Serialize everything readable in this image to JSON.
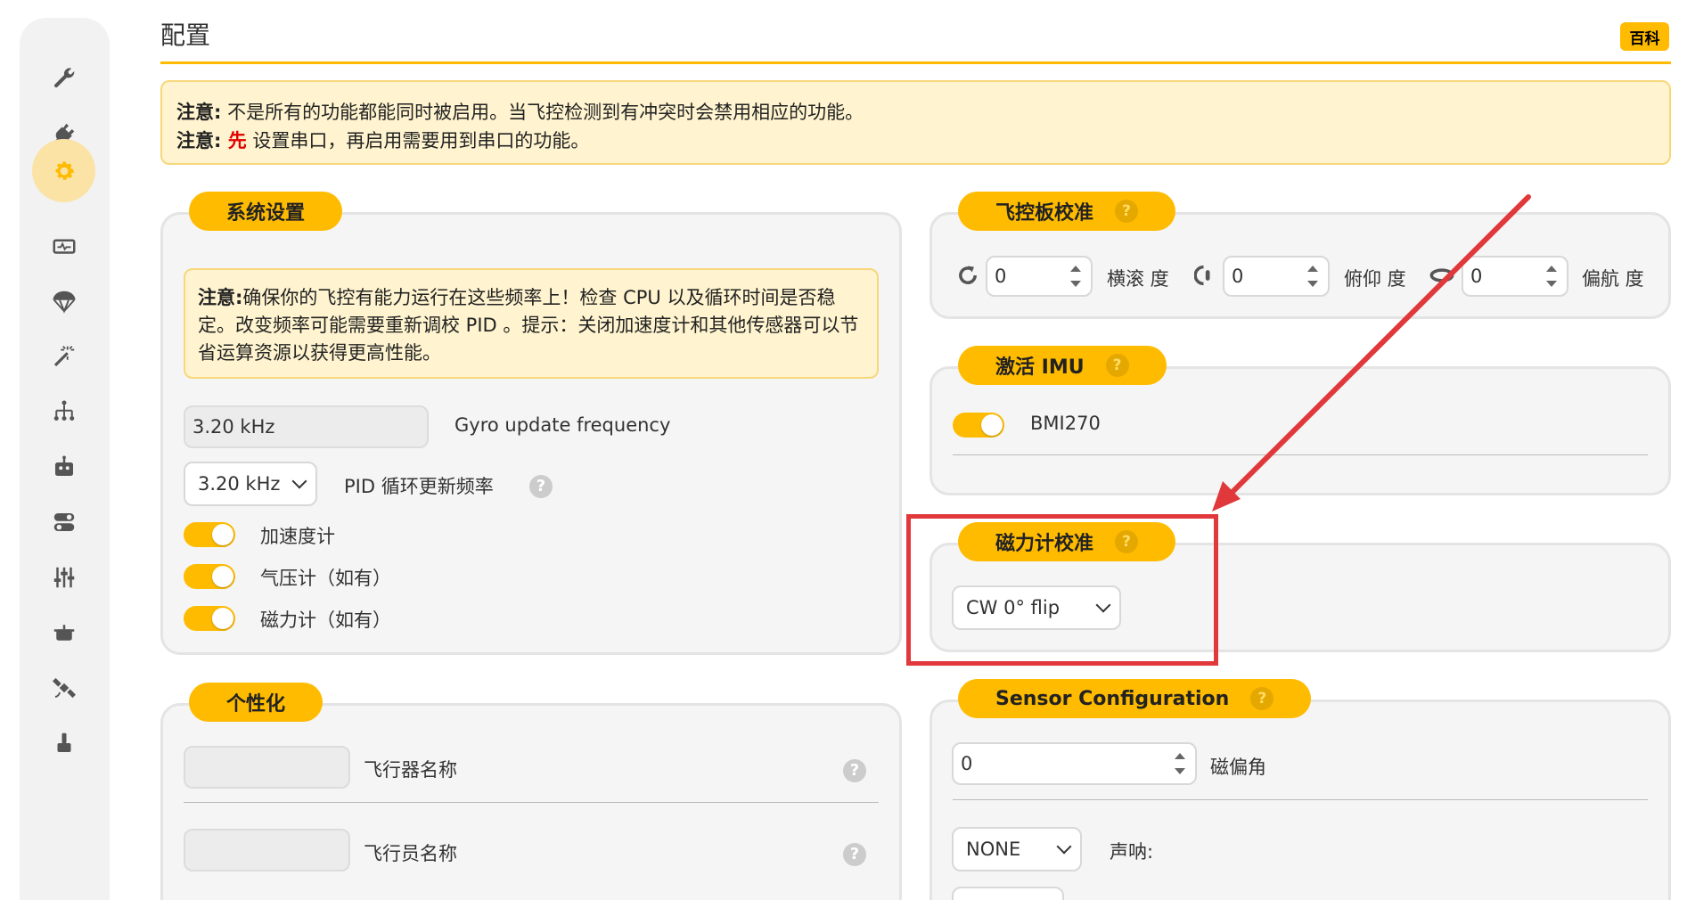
{
  "sidebar": {
    "items": [
      {
        "icon": "wrench-icon",
        "active": false
      },
      {
        "icon": "plug-icon",
        "active": false
      },
      {
        "icon": "gear-icon",
        "active": true
      },
      {
        "icon": "monitor-icon",
        "active": false
      },
      {
        "icon": "parachute-icon",
        "active": false
      },
      {
        "icon": "magic-wand-icon",
        "active": false
      },
      {
        "icon": "network-icon",
        "active": false
      },
      {
        "icon": "robot-icon",
        "active": false
      },
      {
        "icon": "toggles-icon",
        "active": false
      },
      {
        "icon": "sliders-icon",
        "active": false
      },
      {
        "icon": "pot-icon",
        "active": false
      },
      {
        "icon": "satellite-icon",
        "active": false
      },
      {
        "icon": "stamp-icon",
        "active": false
      }
    ]
  },
  "header": {
    "title": "配置",
    "wiki_label": "百科"
  },
  "notice": {
    "line1_prefix": "注意:",
    "line1_text": " 不是所有的功能都能同时被启用。当飞控检测到有冲突时会禁用相应的功能。",
    "line2_prefix": "注意:",
    "line2_highlight": " 先",
    "line2_text": " 设置串口，再启用需要用到串口的功能。"
  },
  "system": {
    "tag": "系统设置",
    "note_prefix": "注意:",
    "note_text": "确保你的飞控有能力运行在这些频率上！检查 CPU 以及循环时间是否稳定。改变频率可能需要重新调校 PID 。提示：关闭加速度计和其他传感器可以节省运算资源以获得更高性能。",
    "gyro_value": "3.20 kHz",
    "gyro_label": "Gyro update frequency",
    "pid_value": "3.20 kHz",
    "pid_label": "PID 循环更新频率",
    "toggles": [
      {
        "label": "加速度计",
        "on": true
      },
      {
        "label": "气压计（如有）",
        "on": true
      },
      {
        "label": "磁力计（如有）",
        "on": true
      }
    ]
  },
  "personal": {
    "tag": "个性化",
    "craft_name_value": "",
    "craft_name_label": "飞行器名称",
    "pilot_name_value": "",
    "pilot_name_label": "飞行员名称"
  },
  "board": {
    "tag": "飞控板校准",
    "help": "?",
    "roll_value": "0",
    "roll_label": "横滚 度",
    "pitch_value": "0",
    "pitch_label": "俯仰 度",
    "yaw_value": "0",
    "yaw_label": "偏航 度"
  },
  "imu": {
    "tag": "激活 IMU",
    "help": "?",
    "sensor_name": "BMI270",
    "enabled": true
  },
  "mag": {
    "tag": "磁力计校准",
    "help": "?",
    "alignment": "CW 0° flip"
  },
  "sensor": {
    "tag": "Sensor Configuration",
    "help": "?",
    "declination_value": "0",
    "declination_label": "磁偏角",
    "sonar_value": "NONE",
    "sonar_label": "声呐:"
  },
  "colors": {
    "accent": "#ffbb00",
    "annotation": "#e0383b"
  }
}
